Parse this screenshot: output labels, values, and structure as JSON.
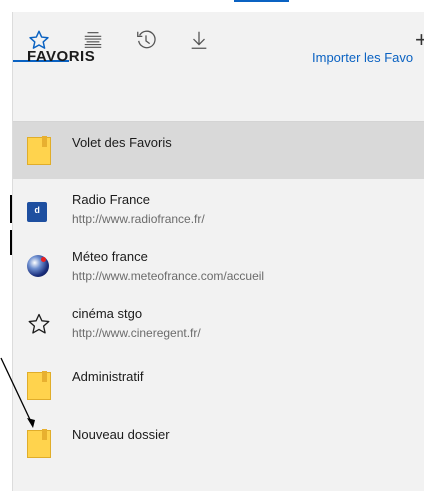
{
  "tabs": [
    {
      "name": "favorites",
      "icon": "star-icon",
      "active": true
    },
    {
      "name": "reading-list",
      "icon": "reading-list-icon",
      "active": false
    },
    {
      "name": "history",
      "icon": "history-icon",
      "active": false
    },
    {
      "name": "downloads",
      "icon": "download-icon",
      "active": false
    }
  ],
  "plus_label": "+",
  "header": {
    "title": "FAVORIS",
    "import_link": "Importer les Favo"
  },
  "items": [
    {
      "name": "Volet des Favoris",
      "url": "",
      "icon": "folder-icon",
      "selected": true
    },
    {
      "name": "Radio France",
      "url": "http://www.radiofrance.fr/",
      "icon": "radio-france-icon",
      "selected": false
    },
    {
      "name": "Méteo france",
      "url": "http://www.meteofrance.com/accueil",
      "icon": "meteo-france-icon",
      "selected": false
    },
    {
      "name": "cinéma stgo",
      "url": "http://www.cineregent.fr/",
      "icon": "star-outline-icon",
      "selected": false
    },
    {
      "name": "Administratif",
      "url": "",
      "icon": "folder-icon",
      "selected": false
    },
    {
      "name": "Nouveau dossier",
      "url": "",
      "icon": "folder-icon",
      "selected": false
    }
  ],
  "colors": {
    "accent": "#0a62c2",
    "panel_bg": "#f2f2f2",
    "selected_bg": "#d9d9d9",
    "folder": "#ffd34d"
  }
}
